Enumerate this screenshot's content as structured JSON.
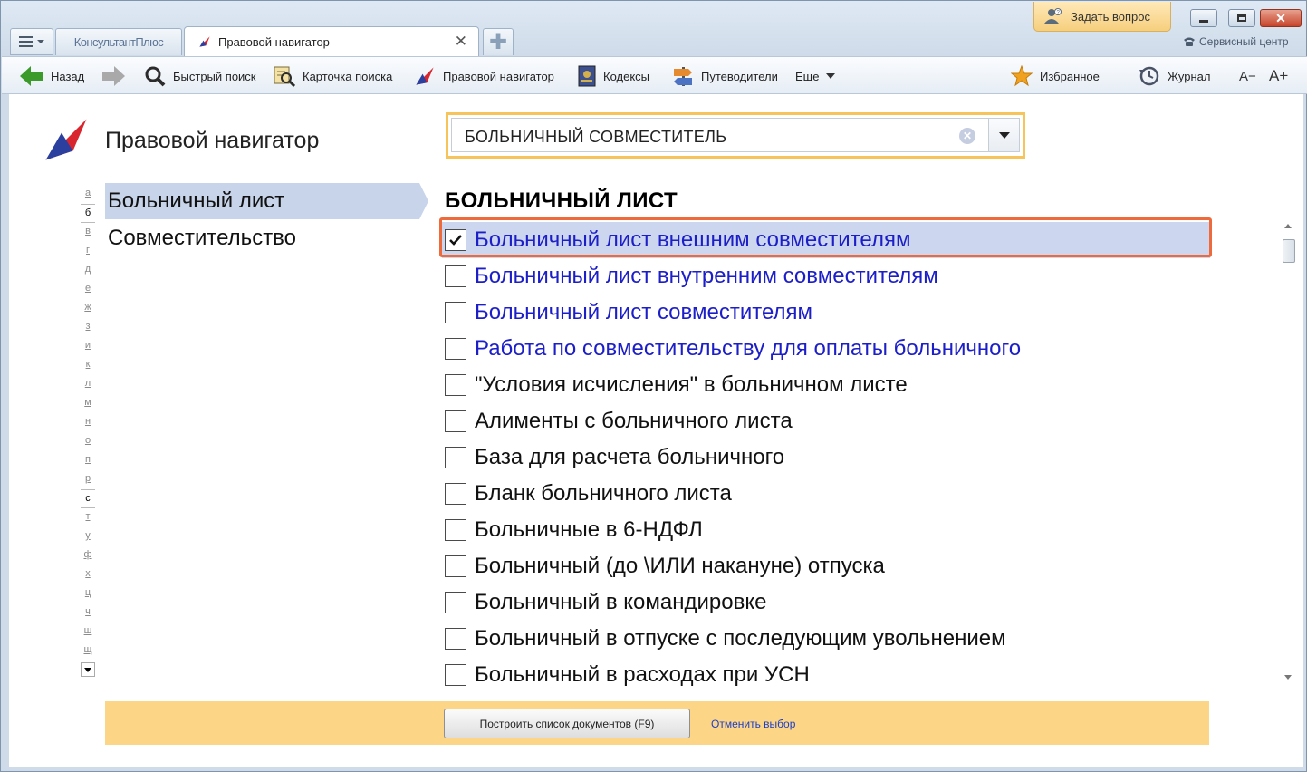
{
  "titlebar": {
    "brand_tab": "КонсультантПлюс",
    "doc_tab": "Правовой навигатор",
    "ask_button": "Задать вопрос",
    "service_center": "Сервисный центр"
  },
  "toolbar": {
    "back": "Назад",
    "quick_search": "Быстрый поиск",
    "search_card": "Карточка поиска",
    "legal_navigator": "Правовой навигатор",
    "codes": "Кодексы",
    "guides": "Путеводители",
    "more": "Еще",
    "favorites": "Избранное",
    "journal": "Журнал",
    "font_smaller": "A−",
    "font_larger": "A+"
  },
  "page": {
    "title": "Правовой навигатор",
    "search_value": "БОЛЬНИЧНЫЙ СОВМЕСТИТЕЛЬ",
    "alphabet": [
      "а",
      "б",
      "в",
      "г",
      "д",
      "е",
      "ж",
      "з",
      "и",
      "к",
      "л",
      "м",
      "н",
      "о",
      "п",
      "р",
      "с",
      "т",
      "у",
      "ф",
      "х",
      "ц",
      "ч",
      "ш",
      "щ"
    ],
    "alphabet_active": [
      "б",
      "с"
    ],
    "categories": [
      "Больничный лист",
      "Совместительство"
    ],
    "selected_category": "Больничный лист",
    "section_heading": "БОЛЬНИЧНЫЙ ЛИСТ",
    "items": [
      {
        "label": "Больничный лист внешним совместителям",
        "checked": true,
        "linked": true
      },
      {
        "label": "Больничный лист внутренним совместителям",
        "checked": false,
        "linked": true
      },
      {
        "label": "Больничный лист совместителям",
        "checked": false,
        "linked": true
      },
      {
        "label": "Работа по совместительству для оплаты больничного",
        "checked": false,
        "linked": true
      },
      {
        "label": "\"Условия исчисления\" в больничном листе",
        "checked": false,
        "linked": false
      },
      {
        "label": "Алименты с больничного листа",
        "checked": false,
        "linked": false
      },
      {
        "label": "База для расчета больничного",
        "checked": false,
        "linked": false
      },
      {
        "label": "Бланк больничного листа",
        "checked": false,
        "linked": false
      },
      {
        "label": "Больничные в 6-НДФЛ",
        "checked": false,
        "linked": false
      },
      {
        "label": "Больничный (до \\ИЛИ накануне) отпуска",
        "checked": false,
        "linked": false
      },
      {
        "label": "Больничный в командировке",
        "checked": false,
        "linked": false
      },
      {
        "label": "Больничный в отпуске с последующим увольнением",
        "checked": false,
        "linked": false
      },
      {
        "label": "Больничный в расходах при УСН",
        "checked": false,
        "linked": false
      }
    ],
    "build_button": "Построить список документов (F9)",
    "cancel_link": "Отменить выбор"
  },
  "colors": {
    "accent_orange": "#ee6a3b",
    "search_border": "#f6c45a",
    "bottom_bar": "#fdd587",
    "link_blue": "#1c1ec8",
    "selection": "#c7d4ea"
  }
}
